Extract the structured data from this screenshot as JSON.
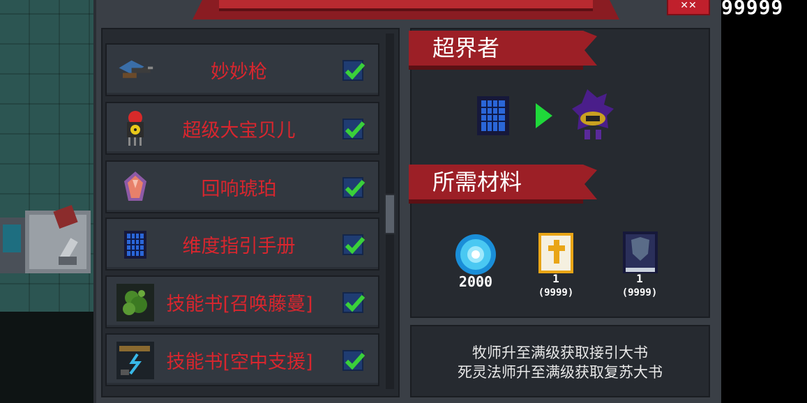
{
  "header": {
    "counter": "99999",
    "close_label": "x"
  },
  "items": [
    {
      "name": "妙妙枪",
      "checked": true,
      "icon": "gun-icon"
    },
    {
      "name": "超级大宝贝儿",
      "checked": true,
      "icon": "bomb-icon"
    },
    {
      "name": "回响琥珀",
      "checked": true,
      "icon": "amber-icon"
    },
    {
      "name": "维度指引手册",
      "checked": true,
      "icon": "manual-icon"
    },
    {
      "name": "技能书[召唤藤蔓]",
      "checked": true,
      "icon": "vine-skillbook-icon"
    },
    {
      "name": "技能书[空中支援]",
      "checked": true,
      "icon": "air-support-skillbook-icon"
    }
  ],
  "detail": {
    "title": "超界者",
    "materials_title": "所需材料",
    "materials": [
      {
        "icon": "gem-icon",
        "amount": "2000",
        "have": ""
      },
      {
        "icon": "holy-book-icon",
        "amount": "1",
        "have": "(9999)"
      },
      {
        "icon": "dark-book-icon",
        "amount": "1",
        "have": "(9999)"
      }
    ],
    "hint_lines": [
      "牧师升至满级获取接引大书",
      "死灵法师升至满级获取复苏大书"
    ]
  },
  "colors": {
    "item_name": "#d8262e",
    "ribbon": "#9c1f26",
    "check": "#3ad03a",
    "panel": "#3a3f46"
  }
}
